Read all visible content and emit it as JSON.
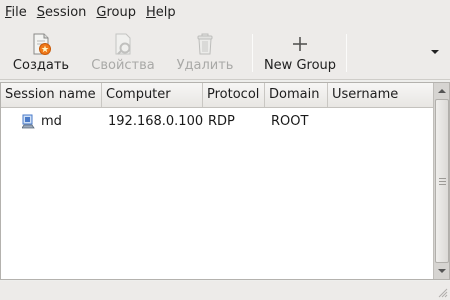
{
  "menubar": {
    "items": [
      {
        "mnemonic": "F",
        "rest": "ile"
      },
      {
        "mnemonic": "S",
        "rest": "ession"
      },
      {
        "mnemonic": "G",
        "rest": "roup"
      },
      {
        "mnemonic": "H",
        "rest": "elp"
      }
    ]
  },
  "toolbar": {
    "create_label": "Создать",
    "properties_label": "Свойства",
    "delete_label": "Удалить",
    "new_group_label": "New Group"
  },
  "table": {
    "columns": [
      "Session name",
      "Computer",
      "Protocol",
      "Domain",
      "Username"
    ],
    "rows": [
      {
        "session_name": "md",
        "computer": "192.168.0.100",
        "protocol": "RDP",
        "domain": "ROOT",
        "username": ""
      }
    ]
  },
  "colors": {
    "background": "#edebe9",
    "list_background": "#ffffff",
    "create_icon_accent": "#f07818",
    "session_icon": "#4a7ac8"
  },
  "icons": {
    "create": "document-new-icon",
    "properties": "properties-icon",
    "delete": "trash-icon",
    "new_group": "plus-icon",
    "overflow": "chevron-down-icon",
    "session": "computer-icon"
  }
}
